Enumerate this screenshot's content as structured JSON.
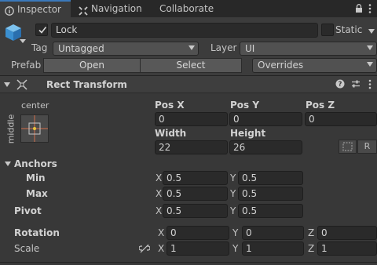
{
  "tabs": [
    {
      "label": "Inspector",
      "icon": "info-icon"
    },
    {
      "label": "Navigation",
      "icon": "navigation-icon"
    },
    {
      "label": "Collaborate"
    }
  ],
  "gameobject": {
    "name": "Lock",
    "active": true,
    "static_label": "Static",
    "static": false,
    "tag_label": "Tag",
    "tag_value": "Untagged",
    "layer_label": "Layer",
    "layer_value": "UI",
    "prefab_label": "Prefab",
    "open_label": "Open",
    "select_label": "Select",
    "overrides_label": "Overrides"
  },
  "rect_transform": {
    "title": "Rect Transform",
    "anchor_preset_h": "center",
    "anchor_preset_v": "middle",
    "pos_x_label": "Pos X",
    "pos_x": "0",
    "pos_y_label": "Pos Y",
    "pos_y": "0",
    "pos_z_label": "Pos Z",
    "pos_z": "0",
    "width_label": "Width",
    "width": "22",
    "height_label": "Height",
    "height": "26",
    "r_label": "R",
    "anchors_label": "Anchors",
    "min_label": "Min",
    "min_x": "0.5",
    "min_y": "0.5",
    "max_label": "Max",
    "max_x": "0.5",
    "max_y": "0.5",
    "pivot_label": "Pivot",
    "pivot_x": "0.5",
    "pivot_y": "0.5",
    "rotation_label": "Rotation",
    "rot_x": "0",
    "rot_y": "0",
    "rot_z": "0",
    "scale_label": "Scale",
    "scale_x": "1",
    "scale_y": "1",
    "scale_z": "1",
    "x_axis": "X",
    "y_axis": "Y",
    "z_axis": "Z"
  },
  "colors": {
    "accent_blue": "#3a79bb",
    "panel_bg": "#383838",
    "field_bg": "#2a2a2a"
  }
}
